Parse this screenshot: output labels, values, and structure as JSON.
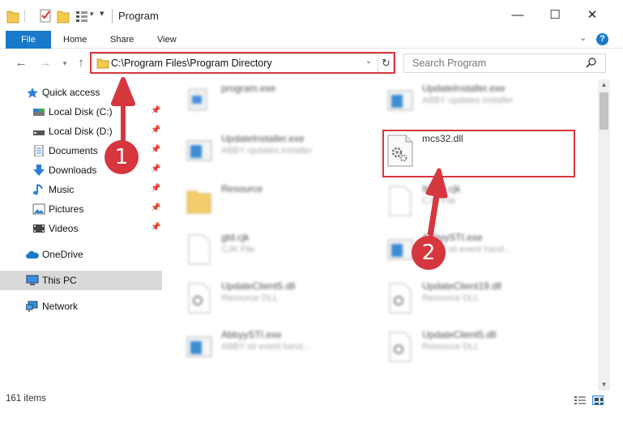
{
  "window": {
    "title": "Program",
    "minimize": "—",
    "maximize": "☐",
    "close": "✕"
  },
  "ribbon": {
    "file": "File",
    "home": "Home",
    "share": "Share",
    "view": "View",
    "help": "?"
  },
  "navigation": {
    "address": "C:\\Program Files\\Program Directory",
    "search_placeholder": "Search Program"
  },
  "sidebar": {
    "items": [
      {
        "label": "Quick access",
        "icon": "star-icon",
        "pinned": false
      },
      {
        "label": "Local Disk (C:)",
        "icon": "drive-icon",
        "pinned": true
      },
      {
        "label": "Local Disk (D:)",
        "icon": "drive-icon",
        "pinned": true
      },
      {
        "label": "Documents",
        "icon": "documents-icon",
        "pinned": true
      },
      {
        "label": "Downloads",
        "icon": "downloads-icon",
        "pinned": true
      },
      {
        "label": "Music",
        "icon": "music-icon",
        "pinned": true
      },
      {
        "label": "Pictures",
        "icon": "pictures-icon",
        "pinned": true
      },
      {
        "label": "Videos",
        "icon": "videos-icon",
        "pinned": true
      },
      {
        "label": "OneDrive",
        "icon": "cloud-icon",
        "pinned": false
      },
      {
        "label": "This PC",
        "icon": "computer-icon",
        "pinned": false
      },
      {
        "label": "Network",
        "icon": "network-icon",
        "pinned": false
      }
    ]
  },
  "files": [
    {
      "name": "program.exe",
      "sub": ""
    },
    {
      "name": "UpdateInstaller.exe",
      "sub": "ABBY updates installer"
    },
    {
      "name": "UpdateInstaller.exe",
      "sub": "ABBY updates installer"
    },
    {
      "name": "mcs32.dll",
      "sub": ""
    },
    {
      "name": "Resource",
      "sub": ""
    },
    {
      "name": "Itcom.cjk",
      "sub": "CJK File"
    },
    {
      "name": "gtd.cjk",
      "sub": "CJK File"
    },
    {
      "name": "AbbyySTI.exe",
      "sub": "ABBY sti event hand..."
    },
    {
      "name": "UpdateClient5.dll",
      "sub": "Resource DLL"
    },
    {
      "name": "UpdateClient19.dll",
      "sub": "Resource DLL"
    },
    {
      "name": "AbbyySTI.exe",
      "sub": "ABBY sti event hand..."
    },
    {
      "name": "UpdateClient5.dll",
      "sub": "Resource DLL"
    }
  ],
  "status": {
    "item_count": "161 items"
  },
  "annotations": {
    "step1": "1",
    "step2": "2",
    "color": "#d6363e"
  }
}
